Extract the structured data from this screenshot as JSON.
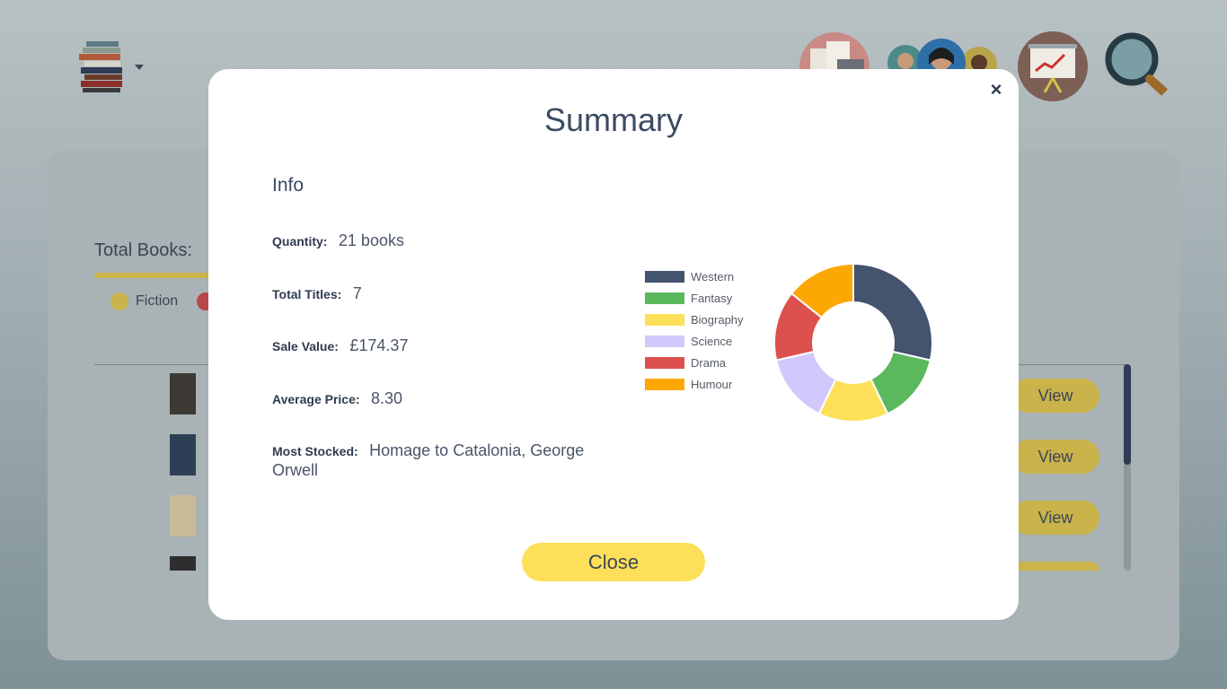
{
  "background": {
    "total_books_label": "Total Books:",
    "legend": [
      {
        "label": "Fiction",
        "color": "#c9b34a"
      },
      {
        "label": "",
        "color": "#b84747"
      }
    ],
    "view_label": "View",
    "book_rows": [
      {
        "cover_color": "#3d3a36"
      },
      {
        "cover_color": "#2d3f55"
      },
      {
        "cover_color": "#c9bb98"
      },
      {
        "cover_color": "#2e2e2e"
      }
    ],
    "header_icons": [
      "books-stack-icon",
      "documents-icon",
      "team-icon",
      "presentation-chart-icon",
      "search-icon"
    ]
  },
  "modal": {
    "title": "Summary",
    "info_heading": "Info",
    "close_icon": "close-icon",
    "info": [
      {
        "label": "Quantity:",
        "value": "21 books"
      },
      {
        "label": "Total Titles:",
        "value": "7"
      },
      {
        "label": "Sale Value:",
        "value": "£174.37"
      },
      {
        "label": "Average Price:",
        "value": "8.30"
      },
      {
        "label": "Most Stocked:",
        "value": "Homage to Catalonia, George Orwell"
      }
    ],
    "close_button": "Close"
  },
  "chart_data": {
    "type": "pie",
    "donut": true,
    "legend_position": "left",
    "categories": [
      "Western",
      "Fantasy",
      "Biography",
      "Science",
      "Drama",
      "Humour"
    ],
    "values": [
      6,
      3,
      3,
      3,
      3,
      3
    ],
    "colors": [
      "#44536e",
      "#5cb85c",
      "#fddf5a",
      "#d2c8fb",
      "#dc514d",
      "#fda802"
    ]
  }
}
